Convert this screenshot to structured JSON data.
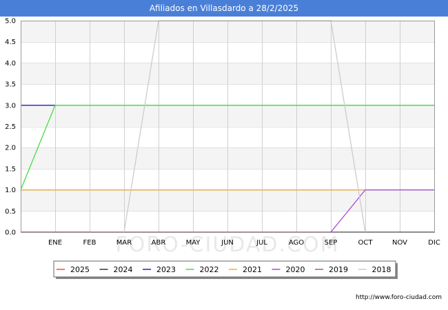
{
  "title": "Afiliados en Villasdardo a 28/2/2025",
  "watermark": "FORO-CIUDAD.COM",
  "footer_url": "http://www.foro-ciudad.com",
  "chart_data": {
    "type": "line",
    "title": "Afiliados en Villasdardo a 28/2/2025",
    "xlabel": "",
    "ylabel": "",
    "categories": [
      "ENE",
      "FEB",
      "MAR",
      "ABR",
      "MAY",
      "JUN",
      "JUL",
      "AGO",
      "SEP",
      "OCT",
      "NOV",
      "DIC"
    ],
    "ylim": [
      0,
      5
    ],
    "yticks": [
      "0.0",
      "0.5",
      "1.0",
      "1.5",
      "2.0",
      "2.5",
      "3.0",
      "3.5",
      "4.0",
      "4.5",
      "5.0"
    ],
    "grid": true,
    "legend_position": "bottom",
    "series": [
      {
        "name": "2025",
        "color": "#ff4444",
        "x": [
          0,
          1,
          2
        ],
        "y": [
          0,
          0,
          0
        ]
      },
      {
        "name": "2024",
        "color": "#333333",
        "x": [
          0,
          1,
          2,
          3,
          4,
          5,
          6,
          7,
          8,
          9,
          10,
          11,
          12
        ],
        "y": [
          0,
          0,
          0,
          0,
          0,
          0,
          0,
          0,
          0,
          0,
          0,
          0,
          0
        ]
      },
      {
        "name": "2023",
        "color": "#2222bb",
        "x": [
          0,
          1
        ],
        "y": [
          3,
          3
        ]
      },
      {
        "name": "2022",
        "color": "#44dd44",
        "x": [
          0,
          1,
          2,
          3,
          4,
          5,
          6,
          7,
          8,
          9,
          10,
          11,
          12
        ],
        "y": [
          1,
          3,
          3,
          3,
          3,
          3,
          3,
          3,
          3,
          3,
          3,
          3,
          3
        ]
      },
      {
        "name": "2021",
        "color": "#ffaa22",
        "x": [
          0,
          1,
          2,
          3,
          4,
          5,
          6,
          7,
          8,
          9,
          10
        ],
        "y": [
          1,
          1,
          1,
          1,
          1,
          1,
          1,
          1,
          1,
          1,
          1
        ]
      },
      {
        "name": "2020",
        "color": "#aa44dd",
        "x": [
          9,
          10,
          11,
          12
        ],
        "y": [
          0,
          1,
          1,
          1
        ]
      },
      {
        "name": "2019",
        "color": "#aa5588",
        "x": [
          0,
          1,
          2,
          3,
          4,
          5,
          6,
          7,
          8,
          9
        ],
        "y": [
          0,
          0,
          0,
          0,
          0,
          0,
          0,
          0,
          0,
          0
        ]
      },
      {
        "name": "2018",
        "color": "#cccccc",
        "x": [
          3,
          4,
          5,
          6,
          7,
          8,
          9,
          10
        ],
        "y": [
          0,
          5,
          5,
          5,
          5,
          5,
          5,
          0
        ]
      }
    ]
  }
}
